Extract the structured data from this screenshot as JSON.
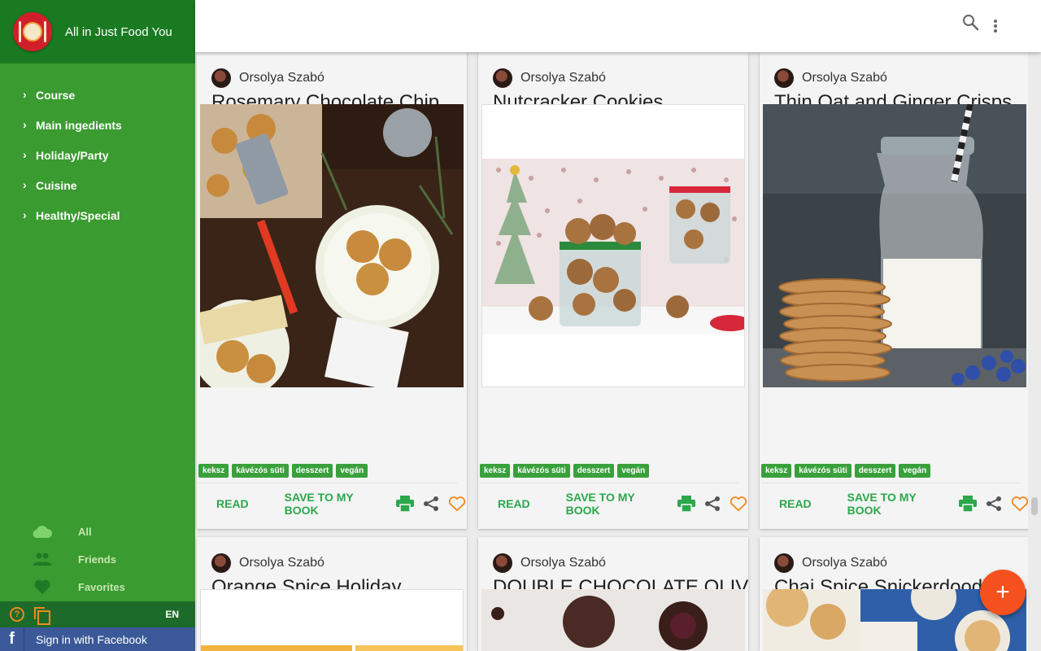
{
  "app": {
    "title": "All in Just Food You"
  },
  "nav": [
    {
      "label": "Course"
    },
    {
      "label": "Main ingedients"
    },
    {
      "label": "Holiday/Party"
    },
    {
      "label": "Cuisine"
    },
    {
      "label": "Healthy/Special"
    }
  ],
  "filters": [
    {
      "label": "All",
      "icon": "cloud-icon"
    },
    {
      "label": "Friends",
      "icon": "people-icon"
    },
    {
      "label": "Favorites",
      "icon": "heart-icon"
    }
  ],
  "footer": {
    "lang": "EN",
    "facebook_label": "Sign in with Facebook"
  },
  "actions": {
    "read": "READ",
    "save": "SAVE TO MY BOOK"
  },
  "tags": [
    "keksz",
    "kávézós süti",
    "desszert",
    "vegán"
  ],
  "cards": [
    {
      "author": "Orsolya Szabó",
      "title": "Rosemary Chocolate Chip"
    },
    {
      "author": "Orsolya Szabó",
      "title": "Nutcracker Cookies"
    },
    {
      "author": "Orsolya Szabó",
      "title": "Thin Oat and Ginger Crisps"
    },
    {
      "author": "Orsolya Szabó",
      "title": "Orange Spice Holiday"
    },
    {
      "author": "Orsolya Szabó",
      "title": "DOUBLE CHOCOLATE OLIVE"
    },
    {
      "author": "Orsolya Szabó",
      "title": "Chai Spice Snickerdoodle"
    }
  ],
  "colors": {
    "primary": "#3a9b30",
    "dark": "#1a7a22",
    "accent": "#f4511e",
    "action": "#2aa84b"
  }
}
